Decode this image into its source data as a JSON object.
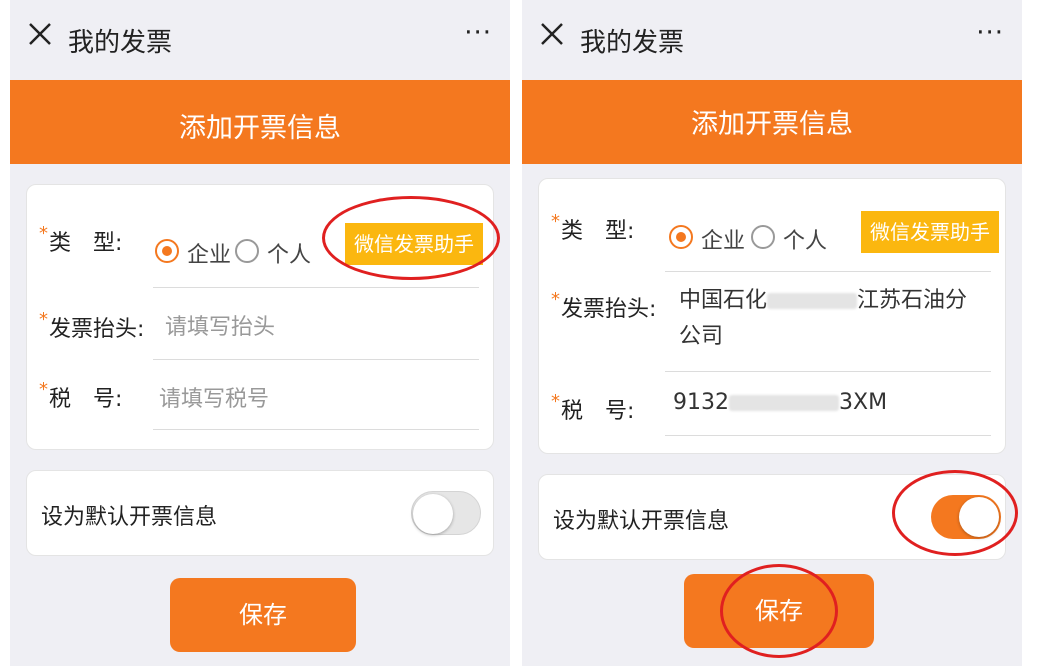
{
  "left": {
    "header": {
      "title": "我的发票",
      "more_label": "···"
    },
    "banner_title": "添加开票信息",
    "form": {
      "type_label": "类　型:",
      "type_options": [
        "企业",
        "个人"
      ],
      "type_selected": "企业",
      "assistant_button": "微信发票助手",
      "title_label": "发票抬头:",
      "title_placeholder": "请填写抬头",
      "tax_label": "税　号:",
      "tax_placeholder": "请填写税号",
      "required_mark": "*"
    },
    "default_label": "设为默认开票信息",
    "default_on": false,
    "save_label": "保存"
  },
  "right": {
    "header": {
      "title": "我的发票",
      "more_label": "···"
    },
    "banner_title": "添加开票信息",
    "form": {
      "type_label": "类　型:",
      "type_options": [
        "企业",
        "个人"
      ],
      "type_selected": "企业",
      "assistant_button": "微信发票助手",
      "title_label": "发票抬头:",
      "title_value_line1": "中国石化",
      "title_value_line1_end": "江苏石油分",
      "title_value_line2": "公司",
      "tax_label": "税　号:",
      "tax_value_start": "9132",
      "tax_value_end": "3XM",
      "required_mark": "*"
    },
    "default_label": "设为默认开票信息",
    "default_on": true,
    "save_label": "保存"
  },
  "colors": {
    "accent": "#f4781f",
    "assistant": "#fbb70f",
    "annotation": "#e02020",
    "background": "#efeff4"
  }
}
